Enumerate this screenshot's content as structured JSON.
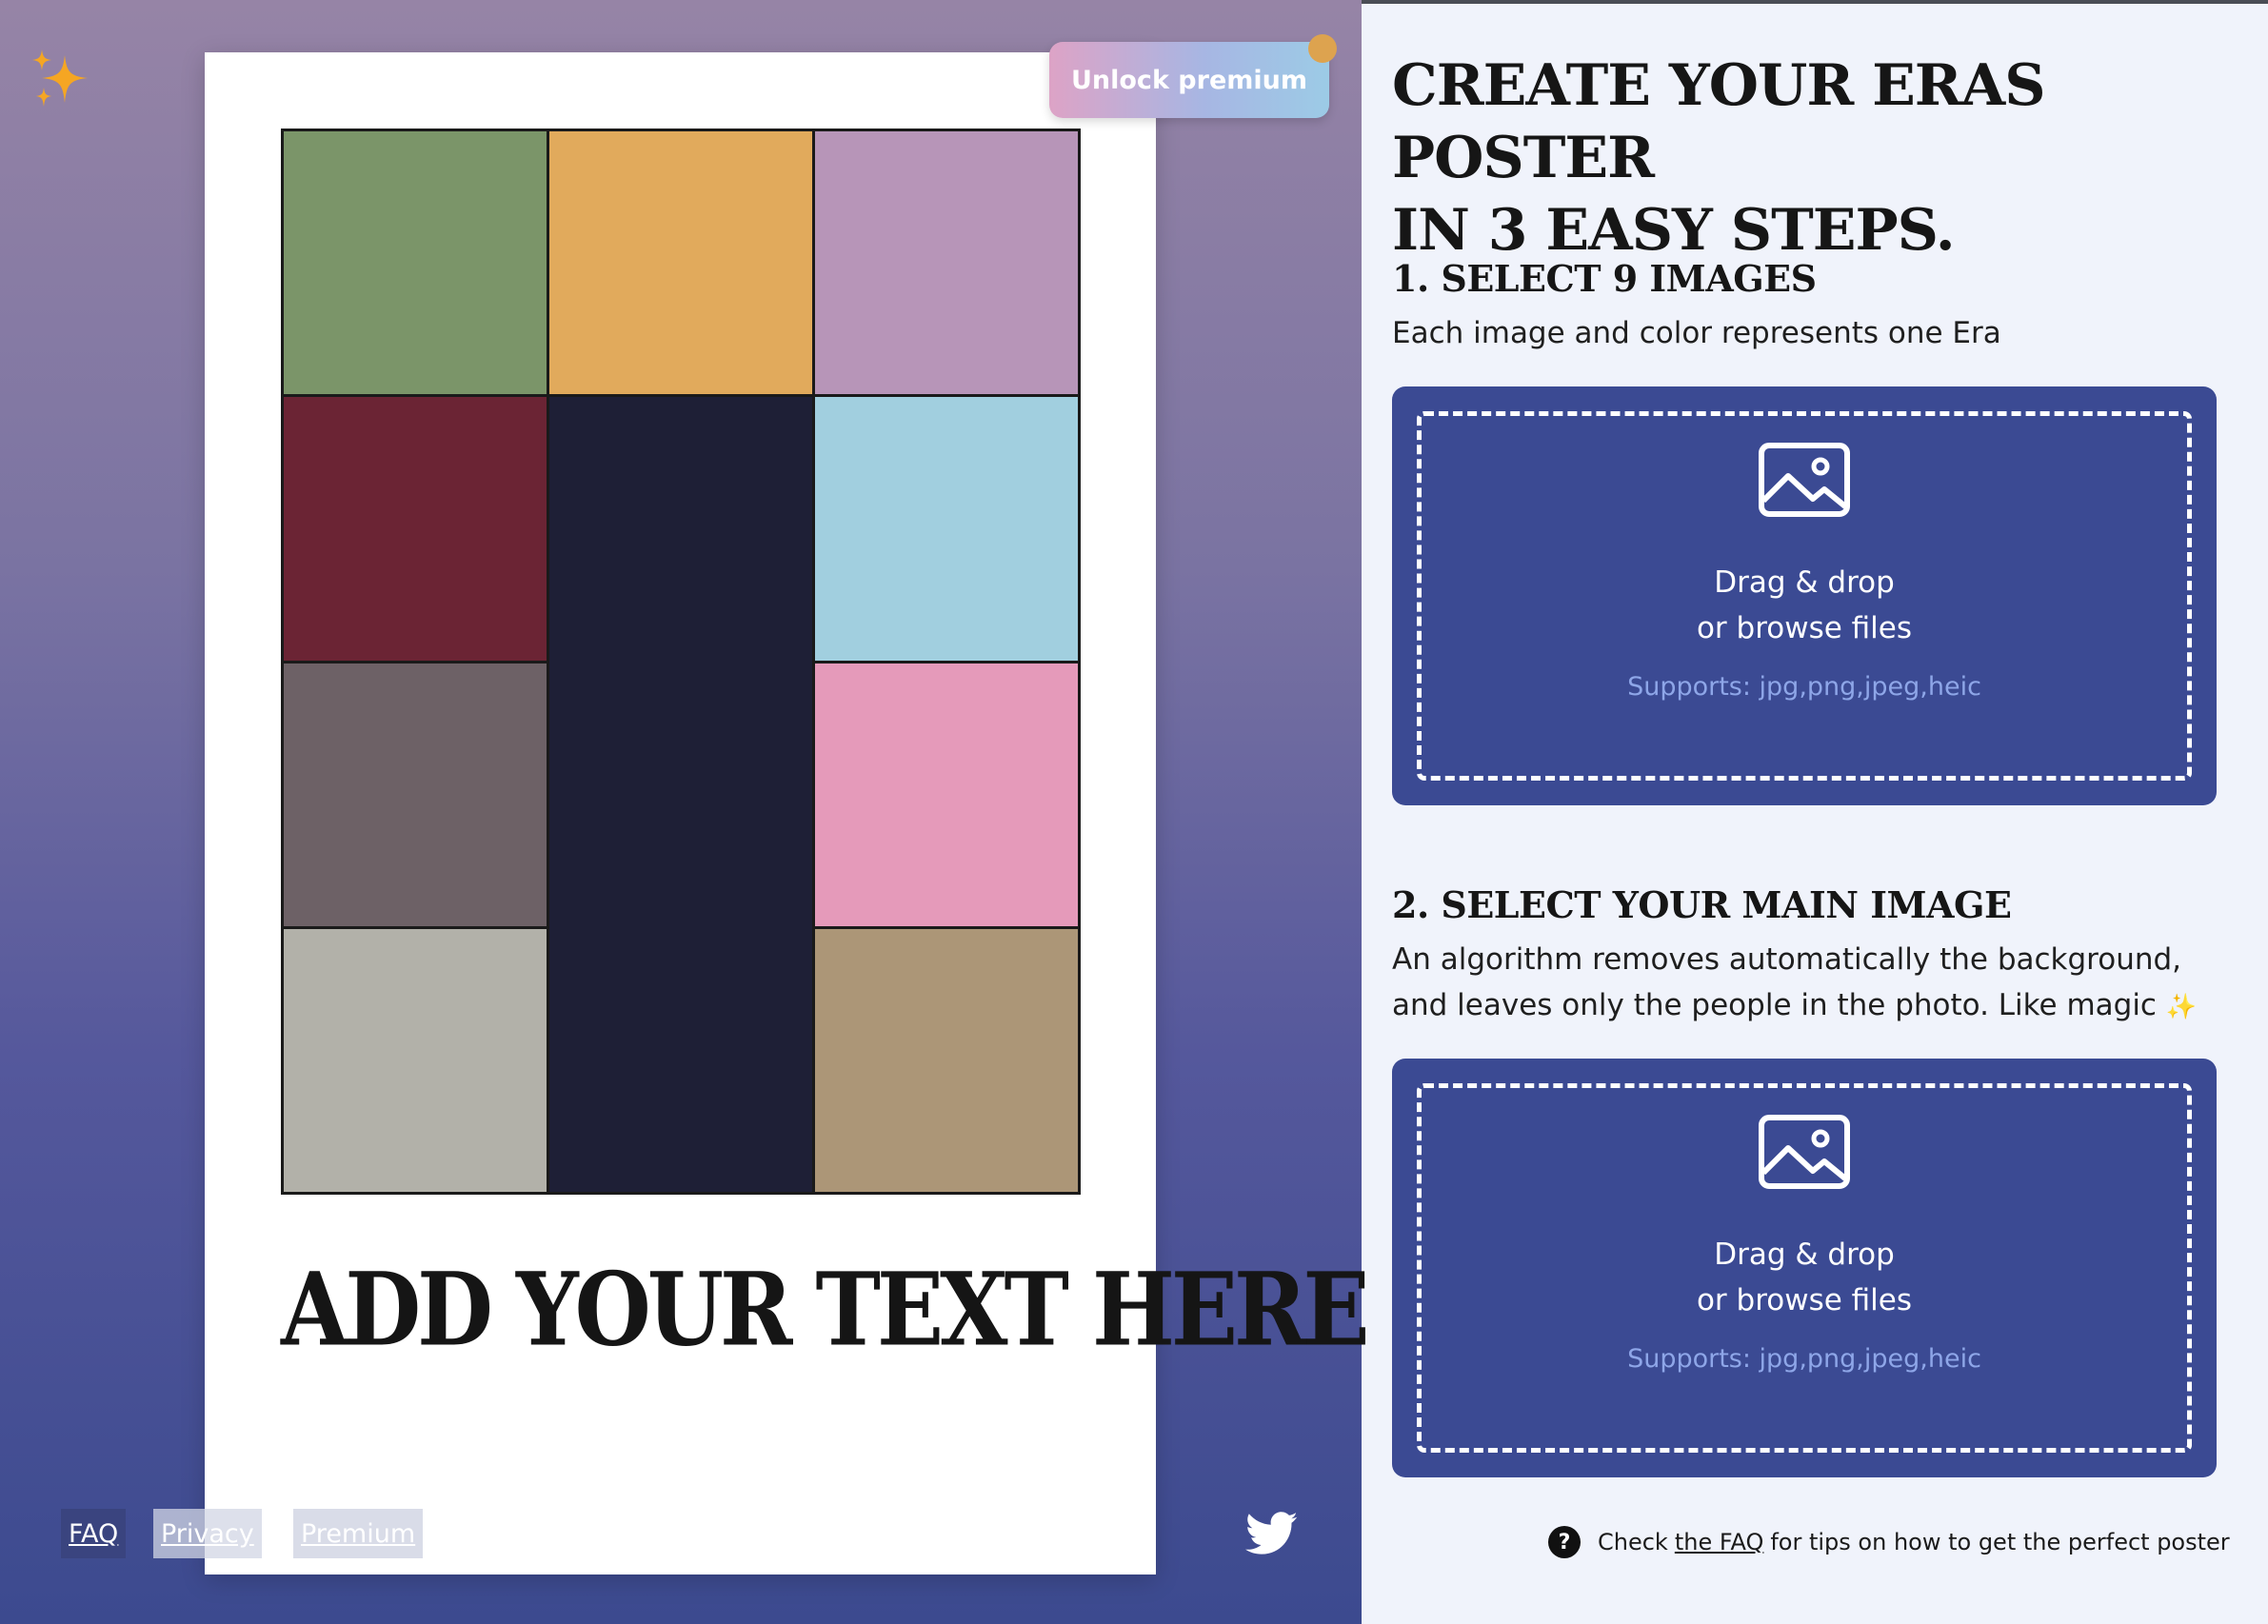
{
  "colors": {
    "left_gradient_top": "#9684a6",
    "left_gradient_bottom": "#3c4a8f",
    "dropzone_bg": "#3b4a93",
    "support_text": "#8ea6e8"
  },
  "poster": {
    "cells": [
      {
        "color": "#7b9569"
      },
      {
        "color": "#e1aa5c"
      },
      {
        "color": "#b795b8"
      },
      {
        "color": "#6b2434"
      },
      {
        "color": "#1e1f36"
      },
      {
        "color": "#a1cfdf"
      },
      {
        "color": "#6d6166"
      },
      {
        "color": "#e59aba"
      },
      {
        "color": "#b2b1a9"
      },
      {
        "color": "#ac9677"
      }
    ],
    "text": "ADD YOUR TEXT HERE"
  },
  "unlock_button": {
    "label": "Unlock premium"
  },
  "footer_links": {
    "faq": "FAQ",
    "privacy": "Privacy",
    "premium": "Premium"
  },
  "heading": {
    "line1": "CREATE YOUR ERAS POSTER",
    "line2": "IN 3 EASY STEPS."
  },
  "step1": {
    "title": "1. SELECT 9 IMAGES",
    "description": "Each image and color represents one Era",
    "dropzone": {
      "line1": "Drag & drop",
      "line2": "or browse files",
      "supports": "Supports: jpg,png,jpeg,heic"
    }
  },
  "step2": {
    "title": "2. SELECT YOUR MAIN IMAGE",
    "description_line1": "An algorithm removes automatically the background,",
    "description_line2": "and leaves only the people in the photo. Like magic",
    "sparkle": "✨",
    "dropzone": {
      "line1": "Drag & drop",
      "line2": "or browse files",
      "supports": "Supports: jpg,png,jpeg,heic"
    }
  },
  "tip": {
    "icon": "?",
    "prefix": "Check",
    "link": "the FAQ",
    "suffix": "for tips on how to get the perfect poster"
  }
}
